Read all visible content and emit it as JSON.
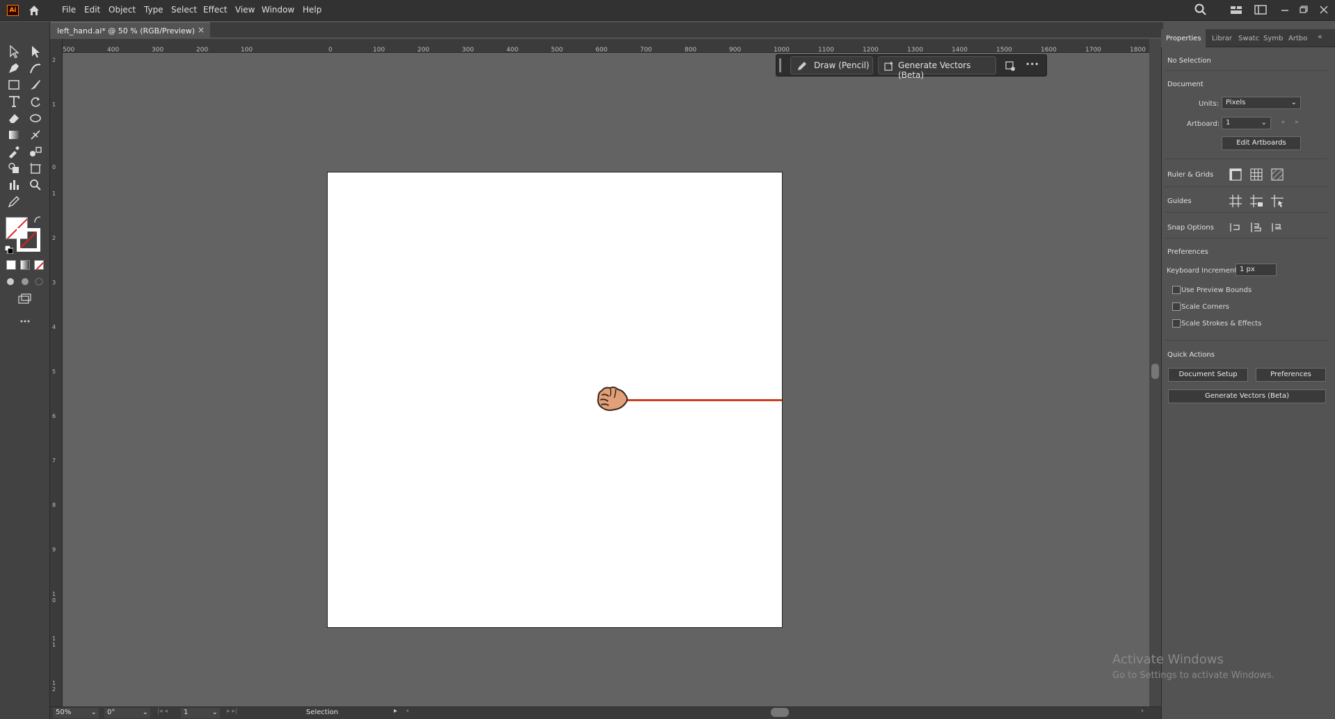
{
  "app": {
    "logo": "Ai",
    "home_icon": "home-icon"
  },
  "menu": [
    "File",
    "Edit",
    "Object",
    "Type",
    "Select",
    "Effect",
    "View",
    "Window",
    "Help"
  ],
  "document_tab": {
    "label": "left_hand.ai* @ 50 % (RGB/Preview)",
    "close": "×"
  },
  "ruler_h": [
    "500",
    "400",
    "300",
    "200",
    "100",
    "0",
    "100",
    "200",
    "300",
    "400",
    "500",
    "600",
    "700",
    "800",
    "900",
    "1000",
    "1100",
    "1200",
    "1300",
    "1400",
    "1500",
    "1600",
    "1700",
    "1800"
  ],
  "ruler_v": [
    "2",
    "1",
    "0",
    "1",
    "2",
    "3",
    "4",
    "5",
    "6",
    "7",
    "8",
    "9",
    "10",
    "11",
    "12"
  ],
  "taskbar": {
    "draw_label": "Draw (Pencil)",
    "generate_label": "Generate Vectors (Beta)",
    "more": "•••"
  },
  "panel": {
    "tabs": [
      "Properties",
      "Librar",
      "Swatc",
      "Symb",
      "Artbo"
    ],
    "no_selection": "No Selection",
    "document_title": "Document",
    "units_label": "Units:",
    "units_value": "Pixels",
    "artboard_label": "Artboard:",
    "artboard_value": "1",
    "edit_artboards": "Edit Artboards",
    "ruler_grids": "Ruler & Grids",
    "guides": "Guides",
    "snap_options": "Snap Options",
    "preferences_title": "Preferences",
    "keyboard_increment_label": "Keyboard Increment:",
    "keyboard_increment_value": "1 px",
    "use_preview_bounds": "Use Preview Bounds",
    "scale_corners": "Scale Corners",
    "scale_strokes": "Scale Strokes & Effects",
    "quick_actions": "Quick Actions",
    "document_setup": "Document Setup",
    "preferences_btn": "Preferences",
    "generate_vectors": "Generate Vectors (Beta)"
  },
  "status": {
    "zoom": "50%",
    "rotation": "0°",
    "artboard_num": "1",
    "tool": "Selection"
  },
  "watermark": {
    "title": "Activate Windows",
    "subtitle": "Go to Settings to activate Windows."
  },
  "colors": {
    "accent_line": "#d23c1e",
    "skin": "#e0a07a"
  }
}
